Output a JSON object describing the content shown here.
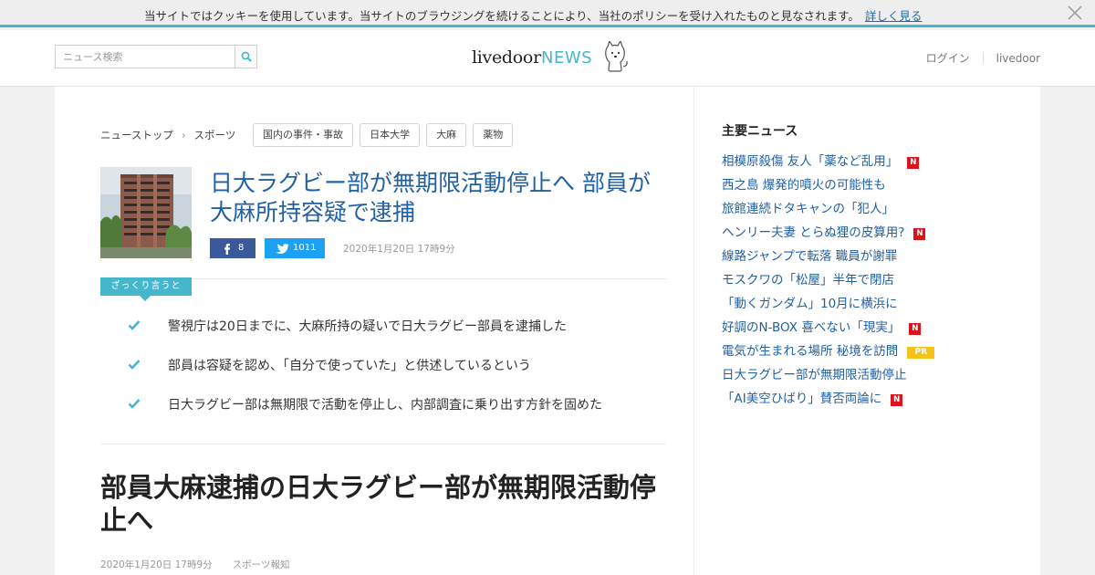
{
  "cookie": {
    "message": "当サイトではクッキーを使用しています。当サイトのブラウジングを続けることにより、当社のポリシーを受け入れたものと見なされます。",
    "link": "詳しく見る"
  },
  "header": {
    "search_placeholder": "ニュース検索",
    "logo_livedoor": "livedoor",
    "logo_news": "NEWS",
    "login": "ログイン",
    "livedoor": "livedoor"
  },
  "breadcrumb": [
    "ニューストップ",
    "スポーツ"
  ],
  "tags": [
    "国内の事件・事故",
    "日本大学",
    "大麻",
    "薬物"
  ],
  "article": {
    "title": "日大ラグビー部が無期限活動停止へ 部員が大麻所持容疑で逮捕",
    "facebook_count": "8",
    "twitter_count": "1011",
    "date": "2020年1月20日 17時9分",
    "summary_label": "ざっくり言うと",
    "points": [
      "警視庁は20日までに、大麻所持の疑いで日大ラグビー部員を逮捕した",
      "部員は容疑を認め、「自分で使っていた」と供述しているという",
      "日大ラグビー部は無期限で活動を停止し、内部調査に乗り出す方針を固めた"
    ],
    "headline": "部員大麻逮捕の日大ラグビー部が無期限活動停止へ",
    "byline_date": "2020年1月20日 17時9分",
    "source": "スポーツ報知"
  },
  "sidebar": {
    "heading": "主要ニュース",
    "items": [
      {
        "text": "相模原殺傷 友人「薬など乱用」",
        "badge": "N"
      },
      {
        "text": "西之島 爆発的噴火の可能性も",
        "badge": ""
      },
      {
        "text": "旅館連続ドタキャンの「犯人」",
        "badge": ""
      },
      {
        "text": "ヘンリー夫妻 とらぬ狸の皮算用?",
        "badge": "N"
      },
      {
        "text": "線路ジャンプで転落 職員が謝罪",
        "badge": ""
      },
      {
        "text": "モスクワの「松屋」半年で閉店",
        "badge": ""
      },
      {
        "text": "「動くガンダム」10月に横浜に",
        "badge": ""
      },
      {
        "text": "好調のN-BOX 喜べない「現実」",
        "badge": "N"
      },
      {
        "text": "電気が生まれる場所 秘境を訪問",
        "badge": "PR"
      },
      {
        "text": "日大ラグビー部が無期限活動停止",
        "badge": ""
      },
      {
        "text": "「AI美空ひばり」賛否両論に",
        "badge": "N"
      }
    ]
  },
  "colors": {
    "accent": "#46b6cd",
    "link": "#2160a4",
    "facebook": "#3b5998",
    "twitter": "#1da1f2",
    "badge_n": "#d7151a",
    "badge_pr": "#f3c21b"
  }
}
